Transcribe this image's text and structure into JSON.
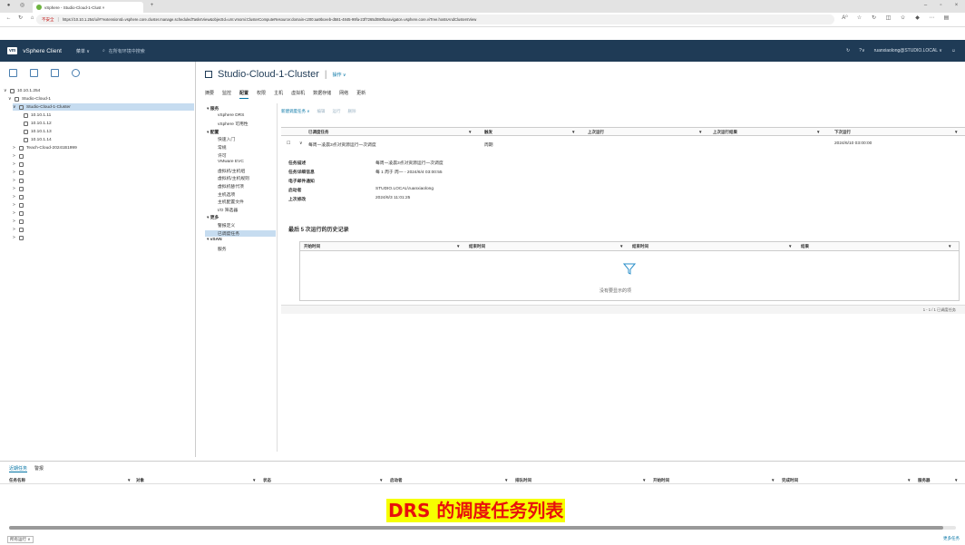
{
  "browser": {
    "tab_title": "vSphere - Studio-Cloud-1-Clust ×",
    "security_warning": "不安全",
    "url": "https://10.10.1.254/ui/#?extensionId=vsphere.core.cluster.manage.scheduledTasksView&objectId=urn:vmomi:ClusterComputeResource:domain-c200:aa9bceeb-d581-4845-99fa-23f7265d080f&navigator=vsphere.core.viTree.hostsAndClustersView",
    "read_aloud": "A⁰"
  },
  "header": {
    "logo": "vm",
    "app_name": "vSphere Client",
    "menu_label": "菜单 ∨",
    "search_placeholder": "在所有环境中搜索",
    "help_label": "?∨",
    "user": "ruanxiaolong@STUDIO.LOCAL ∨"
  },
  "nav": {
    "items": [
      {
        "label": "10.10.1.254",
        "indent": 0
      },
      {
        "label": "Studio-Cloud-1",
        "indent": 1
      },
      {
        "label": "Studio-Cloud-1-Cluster",
        "indent": 2,
        "selected": true
      },
      {
        "label": "10.10.1.11",
        "indent": 3
      },
      {
        "label": "10.10.1.12",
        "indent": 3
      },
      {
        "label": "10.10.1.13",
        "indent": 3
      },
      {
        "label": "10.10.1.14",
        "indent": 3
      },
      {
        "label": "Teach-Cloud-20241B1999",
        "indent": 2
      },
      {
        "label": "",
        "indent": 2
      },
      {
        "label": "",
        "indent": 2
      },
      {
        "label": "",
        "indent": 2
      },
      {
        "label": "",
        "indent": 2
      },
      {
        "label": "",
        "indent": 2
      },
      {
        "label": "",
        "indent": 2
      },
      {
        "label": "",
        "indent": 2
      },
      {
        "label": "",
        "indent": 2
      },
      {
        "label": "",
        "indent": 2
      },
      {
        "label": "",
        "indent": 2
      },
      {
        "label": "",
        "indent": 2
      }
    ]
  },
  "main": {
    "title": "Studio-Cloud-1-Cluster",
    "actions_label": "操作 ∨",
    "tabs": [
      "摘要",
      "监控",
      "配置",
      "权限",
      "主机",
      "虚拟机",
      "数据存储",
      "网络",
      "更新"
    ],
    "active_tab": "配置"
  },
  "settings_tree": [
    {
      "label": "▾ 服务",
      "type": "group"
    },
    {
      "label": "vSphere DRS",
      "type": "item"
    },
    {
      "label": "vSphere 可用性",
      "type": "item"
    },
    {
      "label": "▾ 配置",
      "type": "group"
    },
    {
      "label": "快速入门",
      "type": "item"
    },
    {
      "label": "常规",
      "type": "item"
    },
    {
      "label": "许可",
      "type": "item"
    },
    {
      "label": "VMware EVC",
      "type": "item"
    },
    {
      "label": "虚拟机/主机组",
      "type": "item"
    },
    {
      "label": "虚拟机/主机规则",
      "type": "item"
    },
    {
      "label": "虚拟机替代项",
      "type": "item"
    },
    {
      "label": "主机选项",
      "type": "item"
    },
    {
      "label": "主机配置文件",
      "type": "item"
    },
    {
      "label": "I/O 筛选器",
      "type": "item"
    },
    {
      "label": "▾ 更多",
      "type": "group"
    },
    {
      "label": "警报定义",
      "type": "item"
    },
    {
      "label": "已调度任务",
      "type": "item",
      "selected": true
    },
    {
      "label": "▾ vSAN",
      "type": "group"
    },
    {
      "label": "服务",
      "type": "item"
    }
  ],
  "content": {
    "action_bar": [
      "新建调度任务 ∨",
      "编辑",
      "运行",
      "删除"
    ],
    "grid_headers": [
      "已调度任务",
      "▼",
      "触发",
      "▼",
      "上次运行",
      "▼",
      "上次运行结果",
      "▼",
      "下次运行",
      "▼"
    ],
    "row": {
      "task": "每周一凌晨3点对资源运行一次调度",
      "trigger": "周期",
      "last_run": "",
      "last_result": "",
      "next_run": "2024/6/10 03:00:00"
    },
    "details": [
      {
        "label": "任务描述",
        "value": "每周一凌晨3点对资源运行一次调度"
      },
      {
        "label": "任务详细信息",
        "value": "每 1 周于 周一 - 2024/6/4 03:00:55"
      },
      {
        "label": "电子邮件通知",
        "value": ""
      },
      {
        "label": "启动者",
        "value": "STUDIO.LOCAL\\ruanxiaolong"
      },
      {
        "label": "上次修改",
        "value": "2024/6/3 11:01:25"
      }
    ],
    "history_title": "最后 5 次运行的历史记录",
    "history_headers": [
      "开始时间",
      "▼",
      "结束时间",
      "▼",
      "结束时间",
      "▼",
      "结果",
      "▼"
    ],
    "no_data": "没有要显示的项",
    "pager": "1 - 1 / 1 已调度任务"
  },
  "bottom": {
    "tabs": [
      "近期任务",
      "警报"
    ],
    "headers": [
      "任务名称",
      "▼",
      "对象",
      "▼",
      "状态",
      "▼",
      "启动者",
      "▼",
      "排队时间",
      "▼",
      "开始时间",
      "▼",
      "完成时间",
      "▼",
      "服务器",
      "▼"
    ],
    "filter_label": "所有运行 ∨",
    "more_tasks": "更多任务"
  },
  "caption": "DRS 的调度任务列表",
  "colors": {
    "header_bg": "#1f3b56",
    "link": "#0072a3",
    "selected_bg": "#c6dcf0",
    "caption_bg": "#f6ff00",
    "caption_fg": "#e8100c"
  }
}
